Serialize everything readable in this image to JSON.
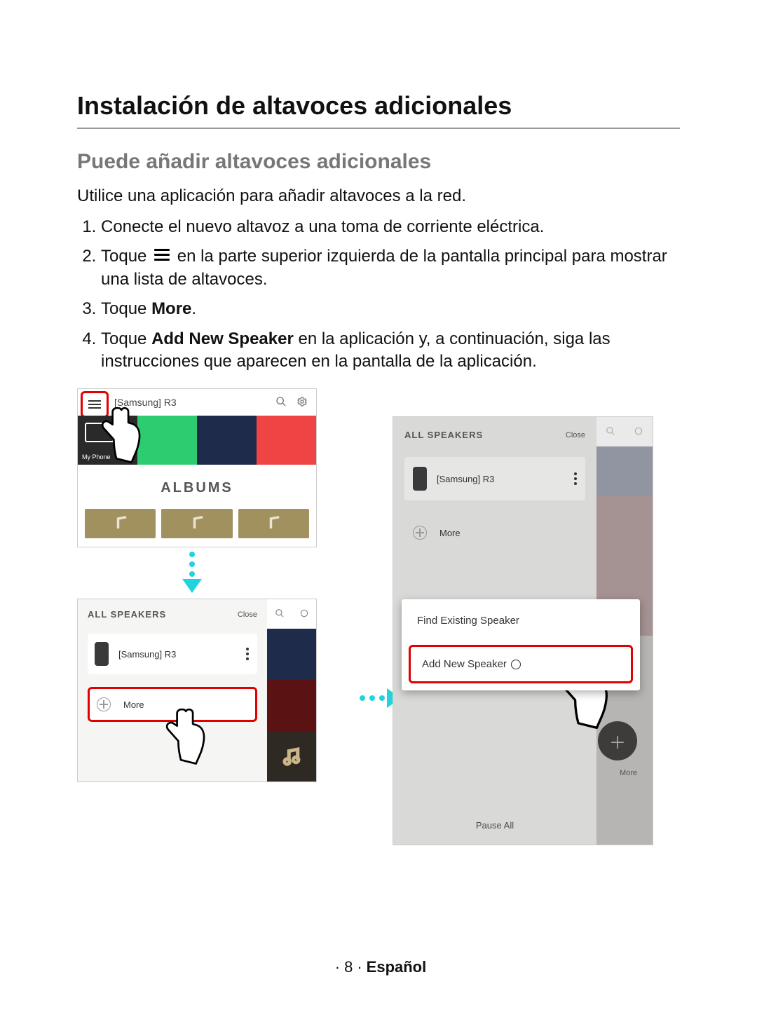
{
  "title": "Instalación de altavoces adicionales",
  "subtitle": "Puede añadir altavoces adicionales",
  "intro": "Utilice una aplicación para añadir altavoces a la red.",
  "steps": {
    "s1": "Conecte el nuevo altavoz a una toma de corriente eléctrica.",
    "s2a": "Toque ",
    "s2b": " en la parte superior izquierda de la pantalla principal para mostrar una lista de altavoces.",
    "s3a": "Toque ",
    "s3b": "More",
    "s3c": ".",
    "s4a": "Toque ",
    "s4b": "Add New Speaker",
    "s4c": " en la aplicación y, a continuación, siga las instrucciones que aparecen en la pantalla de la aplicación."
  },
  "shot1": {
    "title": "[Samsung] R3",
    "myphone": "My Phone",
    "albums": "ALBUMS"
  },
  "shot2": {
    "header": "ALL SPEAKERS",
    "close": "Close",
    "speaker": "[Samsung] R3",
    "more": "More"
  },
  "shot3": {
    "header": "ALL SPEAKERS",
    "close": "Close",
    "speaker": "[Samsung] R3",
    "more": "More",
    "popup_find": "Find Existing Speaker",
    "popup_add": "Add New Speaker",
    "right_more": "More",
    "pause": "Pause All"
  },
  "footer": {
    "page": "8",
    "lang": "Español"
  }
}
